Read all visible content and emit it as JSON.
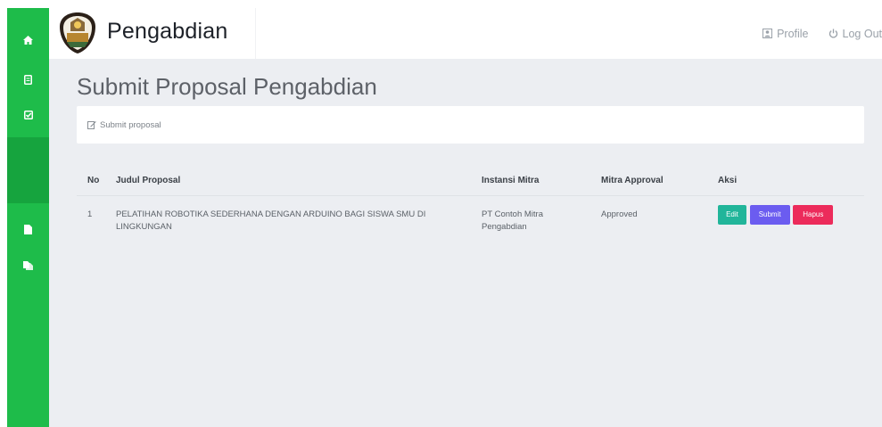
{
  "app": {
    "title": "Pengabdian"
  },
  "nav": {
    "profile_label": "Profile",
    "logout_label": "Log Out"
  },
  "sidebar": {
    "items": [
      {
        "icon": "home-icon"
      },
      {
        "icon": "document-icon"
      },
      {
        "icon": "checked-box-icon"
      },
      {
        "icon": "blank-active-item"
      },
      {
        "icon": "file-icon"
      },
      {
        "icon": "files-icon"
      }
    ]
  },
  "page": {
    "title": "Submit Proposal Pengabdian",
    "panel_label": "Submit proposal"
  },
  "table": {
    "headers": {
      "no": "No",
      "judul": "Judul Proposal",
      "instansi": "Instansi Mitra",
      "approval": "Mitra Approval",
      "aksi": "Aksi"
    },
    "rows": [
      {
        "no": "1",
        "judul": "PELATIHAN ROBOTIKA SEDERHANA DENGAN ARDUINO BAGI SISWA SMU DI LINGKUNGAN",
        "instansi": "PT Contoh Mitra Pengabdian",
        "approval": "Approved",
        "actions": {
          "edit": "Edit",
          "submit": "Submit",
          "hapus": "Hapus"
        }
      }
    ]
  },
  "colors": {
    "sidebar": "#1ebc4a",
    "edit": "#21b59a",
    "submit": "#6b5cf0",
    "hapus": "#ec2b5b"
  }
}
